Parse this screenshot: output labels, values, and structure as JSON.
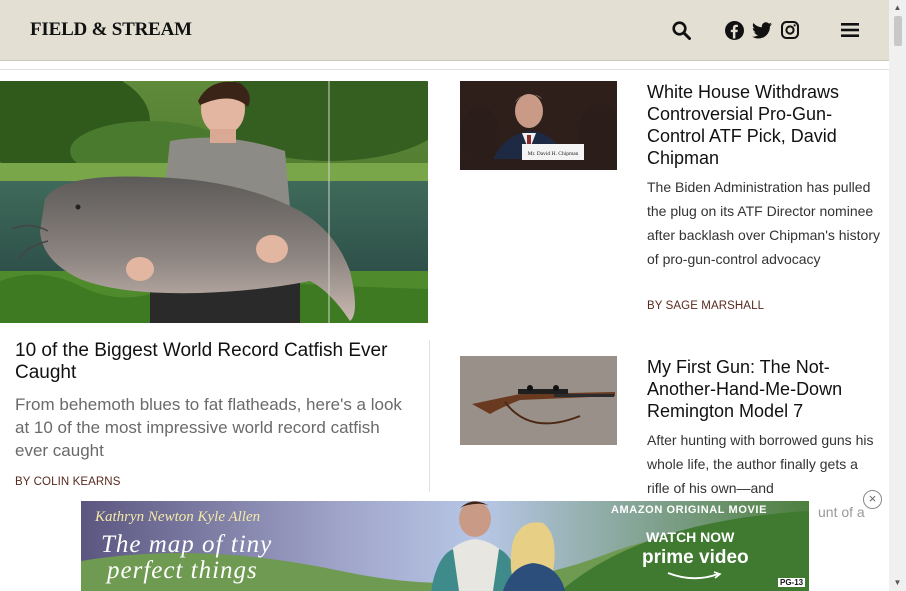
{
  "header": {
    "logo": "FIELD & STREAM",
    "icons": [
      "search-icon",
      "facebook-icon",
      "twitter-icon",
      "instagram-icon",
      "menu-icon"
    ],
    "bg_color": "#e3e0d3"
  },
  "hero": {
    "title": "10 of the Biggest World Record Catfish Ever Caught",
    "dek": "From behemoth blues to fat flatheads, here's a look at 10 of the most impressive world record catfish ever caught",
    "byline": "BY COLIN KEARNS"
  },
  "stories": [
    {
      "title": "White House Withdraws Controversial Pro-Gun-Control ATF Pick, David Chipman",
      "dek": "The Biden Administration has pulled the plug on its ATF Director nominee after backlash over Chipman's history of pro-gun-control advocacy",
      "byline": "BY SAGE MARSHALL",
      "nameplate": "Mr. David H. Chipman"
    },
    {
      "title": "My First Gun: The Not-Another-Hand-Me-Down Remington Model 7",
      "dek": "After hunting with borrowed guns his whole life, the author finally gets a rifle of his own—and",
      "dek_tail": "unt of a"
    }
  ],
  "ad": {
    "actors": "Kathryn Newton   Kyle Allen",
    "movie_title_1": "The map of tiny",
    "movie_title_2": "perfect things",
    "tag": "AMAZON ORIGINAL MOVIE",
    "cta": "WATCH NOW",
    "brand": "prime video",
    "rating": "PG-13",
    "close": "×"
  },
  "colors": {
    "byline": "#5a2a1e",
    "dek_gray": "#6a6a6a"
  }
}
